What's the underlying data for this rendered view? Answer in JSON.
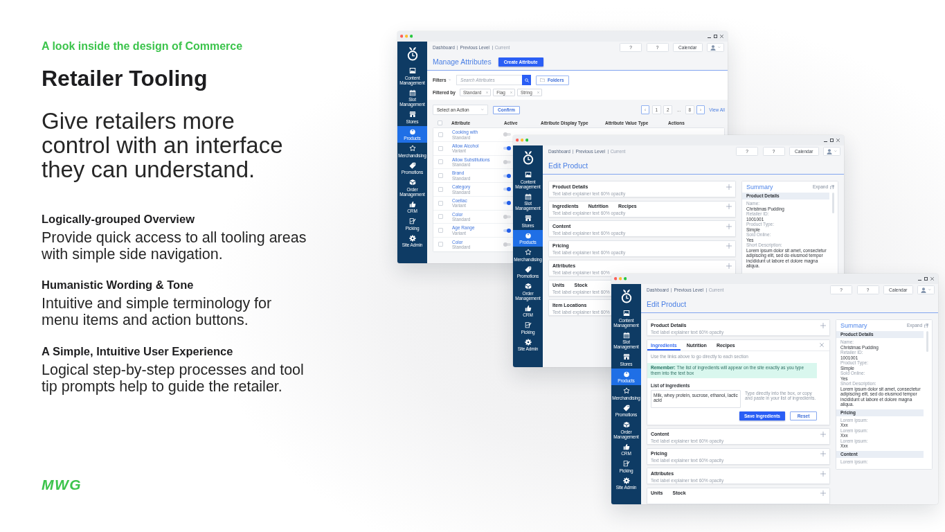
{
  "intro": {
    "eyebrow": "A look inside the design of Commerce",
    "title": "Retailer Tooling",
    "lead": "Give retailers more control with an interface they can understand."
  },
  "features": [
    {
      "heading": "Logically-grouped Overview",
      "text": "Provide quick access to all tooling areas with simple side navigation."
    },
    {
      "heading": "Humanistic Wording & Tone",
      "text": "Intuitive and simple terminology for menu items and action buttons."
    },
    {
      "heading": "A Simple, Intuitive User Experience",
      "text": "Logical step-by-step processes and tool tip prompts help to guide the retailer."
    }
  ],
  "logo": "MWG",
  "windows": [
    {
      "kind": "attribute-list",
      "nav": [
        {
          "label": "Content Management",
          "selected": false
        },
        {
          "label": "Slot Management",
          "selected": false
        },
        {
          "label": "Stores",
          "selected": false
        },
        {
          "label": "Products",
          "selected": true
        },
        {
          "label": "Merchandising",
          "selected": false
        },
        {
          "label": "Promotions",
          "selected": false
        },
        {
          "label": "Order Management",
          "selected": false
        },
        {
          "label": "CRM",
          "selected": false
        },
        {
          "label": "Picking",
          "selected": false
        },
        {
          "label": "Site Admin",
          "selected": false
        }
      ],
      "breadcrumb": [
        {
          "label": "Dashboard",
          "current": false
        },
        {
          "label": "Previous Level",
          "current": false
        },
        {
          "label": "Current",
          "current": true
        }
      ],
      "header_buttons": [
        "?",
        "?",
        "Calendar"
      ],
      "title": "Manage Attributes",
      "primary_button": "Create Attribute",
      "filters": {
        "label": "Filters",
        "search_placeholder": "Search Attributes",
        "folders_button": "Folders",
        "filtered_by": "Filtered by",
        "chips": [
          "Standard",
          "Flag",
          "String"
        ]
      },
      "bulk_action": {
        "select": "Select an Action",
        "button": "Confirm"
      },
      "pagination": {
        "pages": [
          {
            "label": "1",
            "kind": "page",
            "selected": false
          },
          {
            "label": "2",
            "kind": "page",
            "selected": false
          },
          {
            "label": "...",
            "kind": "gap"
          },
          {
            "label": "8",
            "kind": "page",
            "selected": false
          }
        ],
        "view_all": "View All"
      },
      "table": {
        "columns": [
          "Attribute",
          "Active",
          "Attribute Display Type",
          "Attribute Value Type",
          "Actions"
        ],
        "all_checked": false,
        "rows": [
          {
            "name": "Cooking with",
            "type": "Standard",
            "active": false,
            "checked": false
          },
          {
            "name": "Allow Alcohol",
            "type": "Variant",
            "active": true,
            "checked": false
          },
          {
            "name": "Allow Substitutions",
            "type": "Standard",
            "active": false,
            "checked": false
          },
          {
            "name": "Brand",
            "type": "Standard",
            "active": true,
            "checked": false
          },
          {
            "name": "Category",
            "type": "Standard",
            "active": true,
            "checked": false
          },
          {
            "name": "Coeliac",
            "type": "Variant",
            "active": true,
            "checked": false
          },
          {
            "name": "Color",
            "type": "Standard",
            "active": false,
            "checked": false
          },
          {
            "name": "Age Range",
            "type": "Variant",
            "active": true,
            "checked": false
          },
          {
            "name": "Color",
            "type": "Standard",
            "active": false,
            "checked": false
          }
        ]
      }
    },
    {
      "kind": "edit-product",
      "nav": [
        {
          "label": "Content Management",
          "selected": false
        },
        {
          "label": "Slot Management",
          "selected": false
        },
        {
          "label": "Stores",
          "selected": false
        },
        {
          "label": "Products",
          "selected": true
        },
        {
          "label": "Merchandising",
          "selected": false
        },
        {
          "label": "Promotions",
          "selected": false
        },
        {
          "label": "Order Management",
          "selected": false
        },
        {
          "label": "CRM",
          "selected": false
        },
        {
          "label": "Picking",
          "selected": false
        },
        {
          "label": "Site Admin",
          "selected": false
        }
      ],
      "breadcrumb": [
        {
          "label": "Dashboard",
          "current": false
        },
        {
          "label": "Previous Level",
          "current": false
        },
        {
          "label": "Current",
          "current": true
        }
      ],
      "header_buttons": [
        "?",
        "?",
        "Calendar"
      ],
      "title": "Edit Product",
      "sections": [
        {
          "titles": [
            "Product Details"
          ],
          "subtitle": "Text label explainer text 60% opacity",
          "expanded": false
        },
        {
          "titles": [
            "Ingredients",
            "Nutrition",
            "Recipes"
          ],
          "subtitle": "Text label explainer text 60% opacity",
          "expanded": false
        },
        {
          "titles": [
            "Content"
          ],
          "subtitle": "Text label explainer text 60% opacity",
          "expanded": false
        },
        {
          "titles": [
            "Pricing"
          ],
          "subtitle": "Text label explainer text 60% opacity",
          "expanded": false
        },
        {
          "titles": [
            "Attributes"
          ],
          "subtitle": "Text label explainer text 60%",
          "expanded": false
        },
        {
          "titles": [
            "Units",
            "Stock"
          ],
          "subtitle": "Text label explainer text 60%"
        },
        {
          "titles": [
            "Item Locations"
          ],
          "subtitle": "Text label explainer text 60%"
        }
      ],
      "summary": {
        "title": "Summary",
        "expand": "Expand",
        "groups": [
          {
            "heading": "Product Details",
            "fields": [
              {
                "label": "Name:",
                "value": "Christmas Pudding"
              },
              {
                "label": "Retailer ID:",
                "value": "1001001"
              },
              {
                "label": "Product Type:",
                "value": "Simple"
              },
              {
                "label": "Sold Online:",
                "value": "Yes"
              },
              {
                "label": "Short Description:",
                "value": "Lorem ipsum dolor sit amet, consectetur adipiscing elit, sed do eiusmod tempor incididunt ut labore et dolore magna aliqua."
              }
            ]
          }
        ]
      }
    },
    {
      "kind": "edit-product",
      "nav": [
        {
          "label": "Content Management",
          "selected": false
        },
        {
          "label": "Slot Management",
          "selected": false
        },
        {
          "label": "Stores",
          "selected": false
        },
        {
          "label": "Products",
          "selected": true
        },
        {
          "label": "Merchandising",
          "selected": false
        },
        {
          "label": "Promotions",
          "selected": false
        },
        {
          "label": "Order Management",
          "selected": false
        },
        {
          "label": "CRM",
          "selected": false
        },
        {
          "label": "Picking",
          "selected": false
        },
        {
          "label": "Site Admin",
          "selected": false
        }
      ],
      "breadcrumb": [
        {
          "label": "Dashboard",
          "current": false
        },
        {
          "label": "Previous Level",
          "current": false
        },
        {
          "label": "Current",
          "current": true
        }
      ],
      "header_buttons": [
        "?",
        "?",
        "Calendar"
      ],
      "title": "Edit Product",
      "sections": [
        {
          "titles": [
            "Product Details"
          ],
          "subtitle": "Text label explainer text 60% opacity",
          "expanded": false
        },
        {
          "tabs": [
            {
              "label": "Ingredients",
              "selected": true
            },
            {
              "label": "Nutrition",
              "selected": false
            },
            {
              "label": "Recipes",
              "selected": false
            }
          ],
          "expanded": true,
          "hint": "Use the links above to go directly to each section",
          "notice": "**Remember:** The list of ingredients will appear on the site exactly as you type them into the text box",
          "field_label": "List of Ingredients",
          "field_value": "Milk, whey protein, sucrose, ethanol, lactic acid",
          "field_help": "Type directly into the box, or copy and paste in your list of ingredients.",
          "buttons": [
            {
              "label": "Save Ingredients",
              "kind": "primary"
            },
            {
              "label": "Reset",
              "kind": "secondary"
            }
          ]
        },
        {
          "titles": [
            "Content"
          ],
          "subtitle": "Text label explainer text 60% opacity",
          "expanded": false
        },
        {
          "titles": [
            "Pricing"
          ],
          "subtitle": "Text label explainer text 60% opacity",
          "expanded": false
        },
        {
          "titles": [
            "Attributes"
          ],
          "subtitle": "Text label explainer text 60% opacity",
          "expanded": false
        },
        {
          "titles": [
            "Units",
            "Stock"
          ],
          "expanded": false
        }
      ],
      "summary": {
        "title": "Summary",
        "expand": "Expand",
        "groups": [
          {
            "heading": "Product Details",
            "fields": [
              {
                "label": "Name:",
                "value": "Christmas Pudding"
              },
              {
                "label": "Retailer ID:",
                "value": "1001001"
              },
              {
                "label": "Product Type:",
                "value": "Simple"
              },
              {
                "label": "Sold Online:",
                "value": "Yes"
              },
              {
                "label": "Short Description:",
                "value": "Lorem ipsum dolor sit amet, consectetur adipiscing elit, sed do eiusmod tempor incididunt ut labore et dolore magna aliqua."
              }
            ]
          },
          {
            "heading": "Pricing",
            "fields": [
              {
                "label": "Lorem ipsum:",
                "value": "Xxx"
              },
              {
                "label": "Lorem ipsum:",
                "value": "Xxx"
              },
              {
                "label": "Lorem ipsum:",
                "value": "Xxx"
              }
            ]
          },
          {
            "heading": "Content",
            "fields": [
              {
                "label": "Lorem ipsum:"
              }
            ]
          }
        ]
      }
    }
  ]
}
